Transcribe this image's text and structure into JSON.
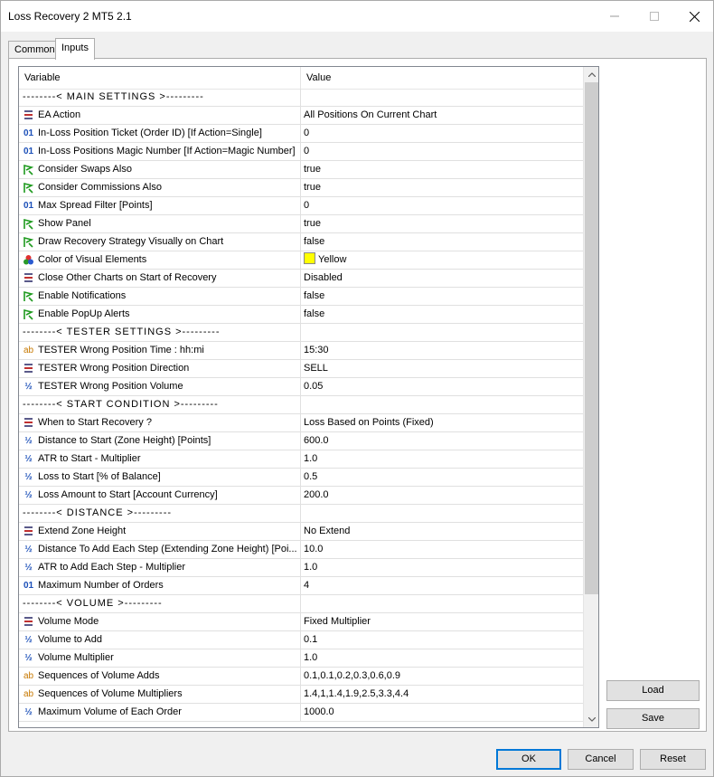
{
  "window": {
    "title": "Loss Recovery 2 MT5 2.1"
  },
  "tabs": [
    {
      "label": "Common"
    },
    {
      "label": "Inputs"
    }
  ],
  "table": {
    "col_variable": "Variable",
    "col_value": "Value"
  },
  "rows": [
    {
      "type": "sec",
      "label": "--------< MAIN SETTINGS >---------",
      "value": ""
    },
    {
      "type": "list",
      "label": "EA Action",
      "value": "All Positions On Current Chart"
    },
    {
      "type": "num",
      "label": "In-Loss Position Ticket (Order ID) [If Action=Single]",
      "value": "0"
    },
    {
      "type": "num",
      "label": "In-Loss Positions Magic Number [If Action=Magic Number]",
      "value": "0"
    },
    {
      "type": "bool",
      "label": "Consider Swaps Also",
      "value": "true"
    },
    {
      "type": "bool",
      "label": "Consider Commissions Also",
      "value": "true"
    },
    {
      "type": "num",
      "label": "Max Spread Filter [Points]",
      "value": "0"
    },
    {
      "type": "bool",
      "label": "Show Panel",
      "value": "true"
    },
    {
      "type": "bool",
      "label": "Draw Recovery Strategy Visually on Chart",
      "value": "false"
    },
    {
      "type": "color",
      "label": "Color of Visual Elements",
      "value": "Yellow"
    },
    {
      "type": "list",
      "label": "Close Other Charts on Start of Recovery",
      "value": "Disabled"
    },
    {
      "type": "bool",
      "label": "Enable Notifications",
      "value": "false"
    },
    {
      "type": "bool",
      "label": "Enable PopUp Alerts",
      "value": "false"
    },
    {
      "type": "sec",
      "label": "--------< TESTER SETTINGS >---------",
      "value": ""
    },
    {
      "type": "ab",
      "label": "TESTER Wrong Position Time : hh:mi",
      "value": "15:30"
    },
    {
      "type": "list",
      "label": "TESTER Wrong Position Direction",
      "value": "SELL"
    },
    {
      "type": "half",
      "label": "TESTER Wrong Position Volume",
      "value": "0.05"
    },
    {
      "type": "sec",
      "label": "--------< START CONDITION >---------",
      "value": ""
    },
    {
      "type": "list",
      "label": "When to Start Recovery ?",
      "value": "Loss Based on Points (Fixed)"
    },
    {
      "type": "half",
      "label": "Distance to Start (Zone Height) [Points]",
      "value": "600.0"
    },
    {
      "type": "half",
      "label": "ATR to Start - Multiplier",
      "value": "1.0"
    },
    {
      "type": "half",
      "label": "Loss to Start [% of Balance]",
      "value": "0.5"
    },
    {
      "type": "half",
      "label": "Loss Amount to Start [Account Currency]",
      "value": "200.0"
    },
    {
      "type": "sec",
      "label": "--------< DISTANCE >---------",
      "value": ""
    },
    {
      "type": "list",
      "label": "Extend Zone Height",
      "value": "No Extend"
    },
    {
      "type": "half",
      "label": "Distance To Add Each Step (Extending Zone Height) [Poi...",
      "value": "10.0"
    },
    {
      "type": "half",
      "label": "ATR to Add Each Step - Multiplier",
      "value": "1.0"
    },
    {
      "type": "num",
      "label": "Maximum Number of Orders",
      "value": "4"
    },
    {
      "type": "sec",
      "label": "--------< VOLUME >---------",
      "value": ""
    },
    {
      "type": "list",
      "label": "Volume Mode",
      "value": "Fixed Multiplier"
    },
    {
      "type": "half",
      "label": "Volume to Add",
      "value": "0.1"
    },
    {
      "type": "half",
      "label": "Volume Multiplier",
      "value": "1.0"
    },
    {
      "type": "ab",
      "label": "Sequences of Volume Adds",
      "value": "0.1,0.1,0.2,0.3,0.6,0.9"
    },
    {
      "type": "ab",
      "label": "Sequences of Volume Multipliers",
      "value": "1.4,1,1.4,1.9,2.5,3.3,4.4"
    },
    {
      "type": "half",
      "label": "Maximum Volume of Each Order",
      "value": "1000.0"
    }
  ],
  "icons": {
    "num": "01",
    "half": "½",
    "ab": "ab"
  },
  "colors": {
    "visual_element_color": "#ffff00",
    "accent": "#0078d7"
  },
  "buttons": {
    "load": "Load",
    "save": "Save",
    "ok": "OK",
    "cancel": "Cancel",
    "reset": "Reset"
  }
}
